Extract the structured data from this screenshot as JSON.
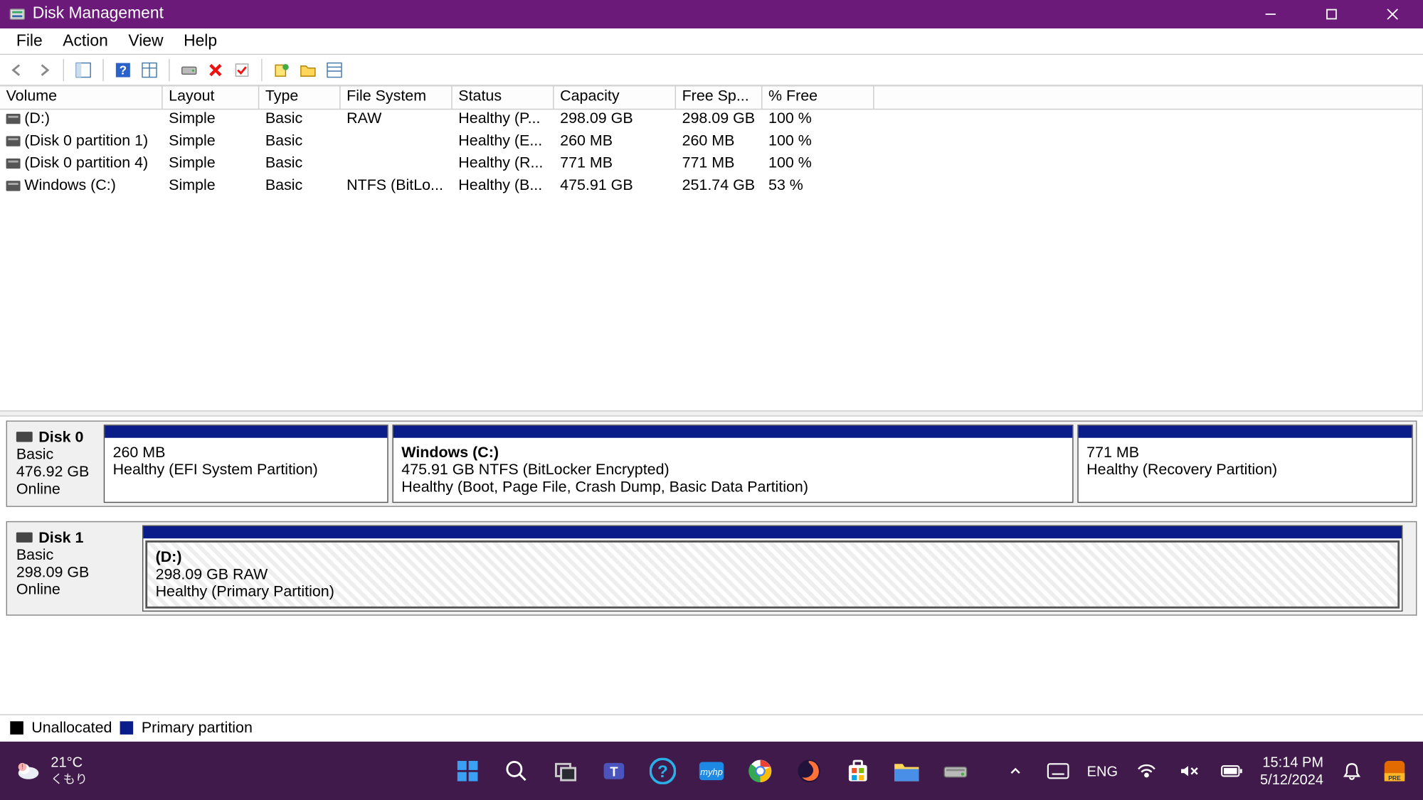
{
  "window": {
    "title": "Disk Management"
  },
  "menu": {
    "file": "File",
    "action": "Action",
    "view": "View",
    "help": "Help"
  },
  "columns": {
    "volume": "Volume",
    "layout": "Layout",
    "type": "Type",
    "fs": "File System",
    "status": "Status",
    "capacity": "Capacity",
    "free": "Free Sp...",
    "pct": "% Free"
  },
  "volumes": [
    {
      "name": "(D:)",
      "layout": "Simple",
      "type": "Basic",
      "fs": "RAW",
      "status": "Healthy (P...",
      "capacity": "298.09 GB",
      "free": "298.09 GB",
      "pct": "100 %"
    },
    {
      "name": "(Disk 0 partition 1)",
      "layout": "Simple",
      "type": "Basic",
      "fs": "",
      "status": "Healthy (E...",
      "capacity": "260 MB",
      "free": "260 MB",
      "pct": "100 %"
    },
    {
      "name": "(Disk 0 partition 4)",
      "layout": "Simple",
      "type": "Basic",
      "fs": "",
      "status": "Healthy (R...",
      "capacity": "771 MB",
      "free": "771 MB",
      "pct": "100 %"
    },
    {
      "name": "Windows (C:)",
      "layout": "Simple",
      "type": "Basic",
      "fs": "NTFS (BitLo...",
      "status": "Healthy (B...",
      "capacity": "475.91 GB",
      "free": "251.74 GB",
      "pct": "53 %"
    }
  ],
  "disks": [
    {
      "name": "Disk 0",
      "type": "Basic",
      "size": "476.92 GB",
      "status": "Online",
      "partitions": [
        {
          "name": "",
          "line1": "260 MB",
          "line2": "Healthy (EFI System Partition)",
          "widthpx": 280,
          "hatched": false
        },
        {
          "name": "Windows  (C:)",
          "line1": "475.91 GB NTFS (BitLocker Encrypted)",
          "line2": "Healthy (Boot, Page File, Crash Dump, Basic Data Partition)",
          "widthpx": 670,
          "hatched": false
        },
        {
          "name": "",
          "line1": "771 MB",
          "line2": "Healthy (Recovery Partition)",
          "widthpx": 330,
          "hatched": false
        }
      ]
    },
    {
      "name": "Disk 1",
      "type": "Basic",
      "size": "298.09 GB",
      "status": "Online",
      "partitions": [
        {
          "name": "  (D:)",
          "line1": "298.09 GB RAW",
          "line2": "Healthy (Primary Partition)",
          "widthpx": 1240,
          "hatched": true
        }
      ]
    }
  ],
  "legend": {
    "unallocated": "Unallocated",
    "primary": "Primary partition"
  },
  "taskbar": {
    "weather": {
      "temp": "21°C",
      "cond": "くもり"
    },
    "lang": "ENG",
    "time": "15:14 PM",
    "date": "5/12/2024"
  }
}
